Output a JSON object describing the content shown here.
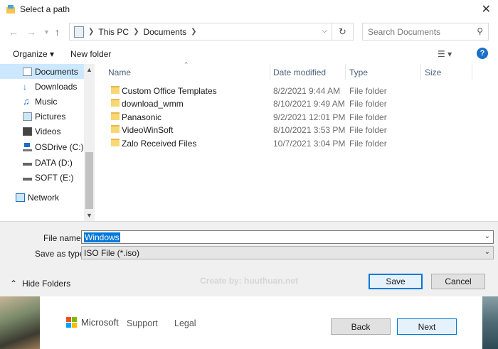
{
  "dialog": {
    "title": "Select a path",
    "close_glyph": "✕"
  },
  "address_bar": {
    "crumbs": [
      "This PC",
      "Documents"
    ],
    "search_placeholder": "Search Documents"
  },
  "toolbar": {
    "organize_label": "Organize ▾",
    "new_folder_label": "New folder",
    "help_label": "?"
  },
  "nav_pane": {
    "items": [
      {
        "label": "Documents",
        "icon": "documents-icon",
        "selected": true
      },
      {
        "label": "Downloads",
        "icon": "downloads-icon"
      },
      {
        "label": "Music",
        "icon": "music-icon"
      },
      {
        "label": "Pictures",
        "icon": "pictures-icon"
      },
      {
        "label": "Videos",
        "icon": "videos-icon"
      },
      {
        "label": "OSDrive (C:)",
        "icon": "drive-c-icon"
      },
      {
        "label": "DATA (D:)",
        "icon": "drive-icon"
      },
      {
        "label": "SOFT (E:)",
        "icon": "drive-icon"
      },
      {
        "label": "Network",
        "icon": "network-icon"
      }
    ]
  },
  "file_list": {
    "columns": {
      "name": "Name",
      "date": "Date modified",
      "type": "Type",
      "size": "Size"
    },
    "rows": [
      {
        "name": "Custom Office Templates",
        "date": "8/2/2021 9:44 AM",
        "type": "File folder"
      },
      {
        "name": "download_wmm",
        "date": "8/10/2021 9:49 AM",
        "type": "File folder"
      },
      {
        "name": "Panasonic",
        "date": "9/2/2021 12:01 PM",
        "type": "File folder"
      },
      {
        "name": "VideoWinSoft",
        "date": "8/10/2021 3:53 PM",
        "type": "File folder"
      },
      {
        "name": "Zalo Received Files",
        "date": "10/7/2021 3:04 PM",
        "type": "File folder"
      }
    ]
  },
  "save_form": {
    "file_name_label": "File name:",
    "file_name_value": "Windows",
    "save_type_label": "Save as type:",
    "save_type_value": "ISO File (*.iso)",
    "hide_folders_label": "Hide Folders",
    "watermark": "Create by: huuthuan.net",
    "save_button": "Save",
    "cancel_button": "Cancel"
  },
  "installer": {
    "brand": "Microsoft",
    "support_link": "Support",
    "legal_link": "Legal",
    "back_button": "Back",
    "next_button": "Next",
    "brand_colors": [
      "#f25022",
      "#7fba00",
      "#00a4ef",
      "#ffb900"
    ]
  }
}
